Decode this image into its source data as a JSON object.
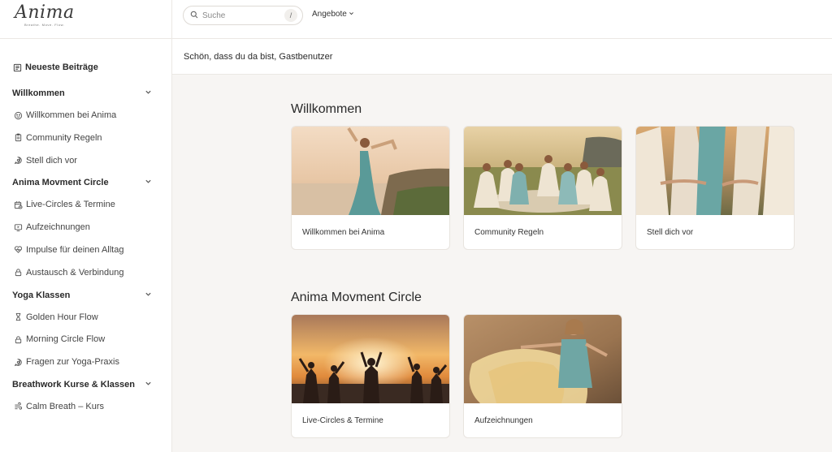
{
  "brand": {
    "logo_text": "Anima",
    "logo_tagline": "Breathe. Move. Flow."
  },
  "topbar": {
    "search_placeholder": "Suche",
    "search_shortcut": "/",
    "offers_label": "Angebote"
  },
  "greeting": "Schön, dass du da bist, Gastbenutzer",
  "sidebar": {
    "latest": "Neueste Beiträge",
    "sections": [
      {
        "title": "Willkommen",
        "items": [
          {
            "label": "Willkommen bei Anima",
            "icon": "smiley-icon"
          },
          {
            "label": "Community Regeln",
            "icon": "clipboard-icon"
          },
          {
            "label": "Stell dich vor",
            "icon": "chat-icon"
          }
        ]
      },
      {
        "title": "Anima Movment Circle",
        "items": [
          {
            "label": "Live-Circles & Termine",
            "icon": "calendar-icon"
          },
          {
            "label": "Aufzeichnungen",
            "icon": "video-icon"
          },
          {
            "label": "Impulse für deinen Alltag",
            "icon": "heart-icon"
          },
          {
            "label": "Austausch & Verbindung",
            "icon": "lock-icon"
          }
        ]
      },
      {
        "title": "Yoga Klassen",
        "items": [
          {
            "label": "Golden Hour Flow",
            "icon": "hourglass-icon"
          },
          {
            "label": "Morning Circle Flow",
            "icon": "lock-icon"
          },
          {
            "label": "Fragen zur Yoga-Praxis",
            "icon": "chat-icon"
          }
        ]
      },
      {
        "title": "Breathwork Kurse & Klassen",
        "items": [
          {
            "label": "Calm Breath – Kurs",
            "icon": "wind-icon"
          }
        ]
      }
    ]
  },
  "main": {
    "sections": [
      {
        "title": "Willkommen",
        "cards": [
          {
            "label": "Willkommen bei Anima",
            "image": "yoga-cliff-photo"
          },
          {
            "label": "Community Regeln",
            "image": "women-circle-photo"
          },
          {
            "label": "Stell dich vor",
            "image": "holding-hands-photo"
          }
        ]
      },
      {
        "title": "Anima Movment Circle",
        "cards": [
          {
            "label": "Live-Circles & Termine",
            "image": "sunset-dance-photo"
          },
          {
            "label": "Aufzeichnungen",
            "image": "flowing-dress-photo"
          }
        ]
      }
    ]
  }
}
